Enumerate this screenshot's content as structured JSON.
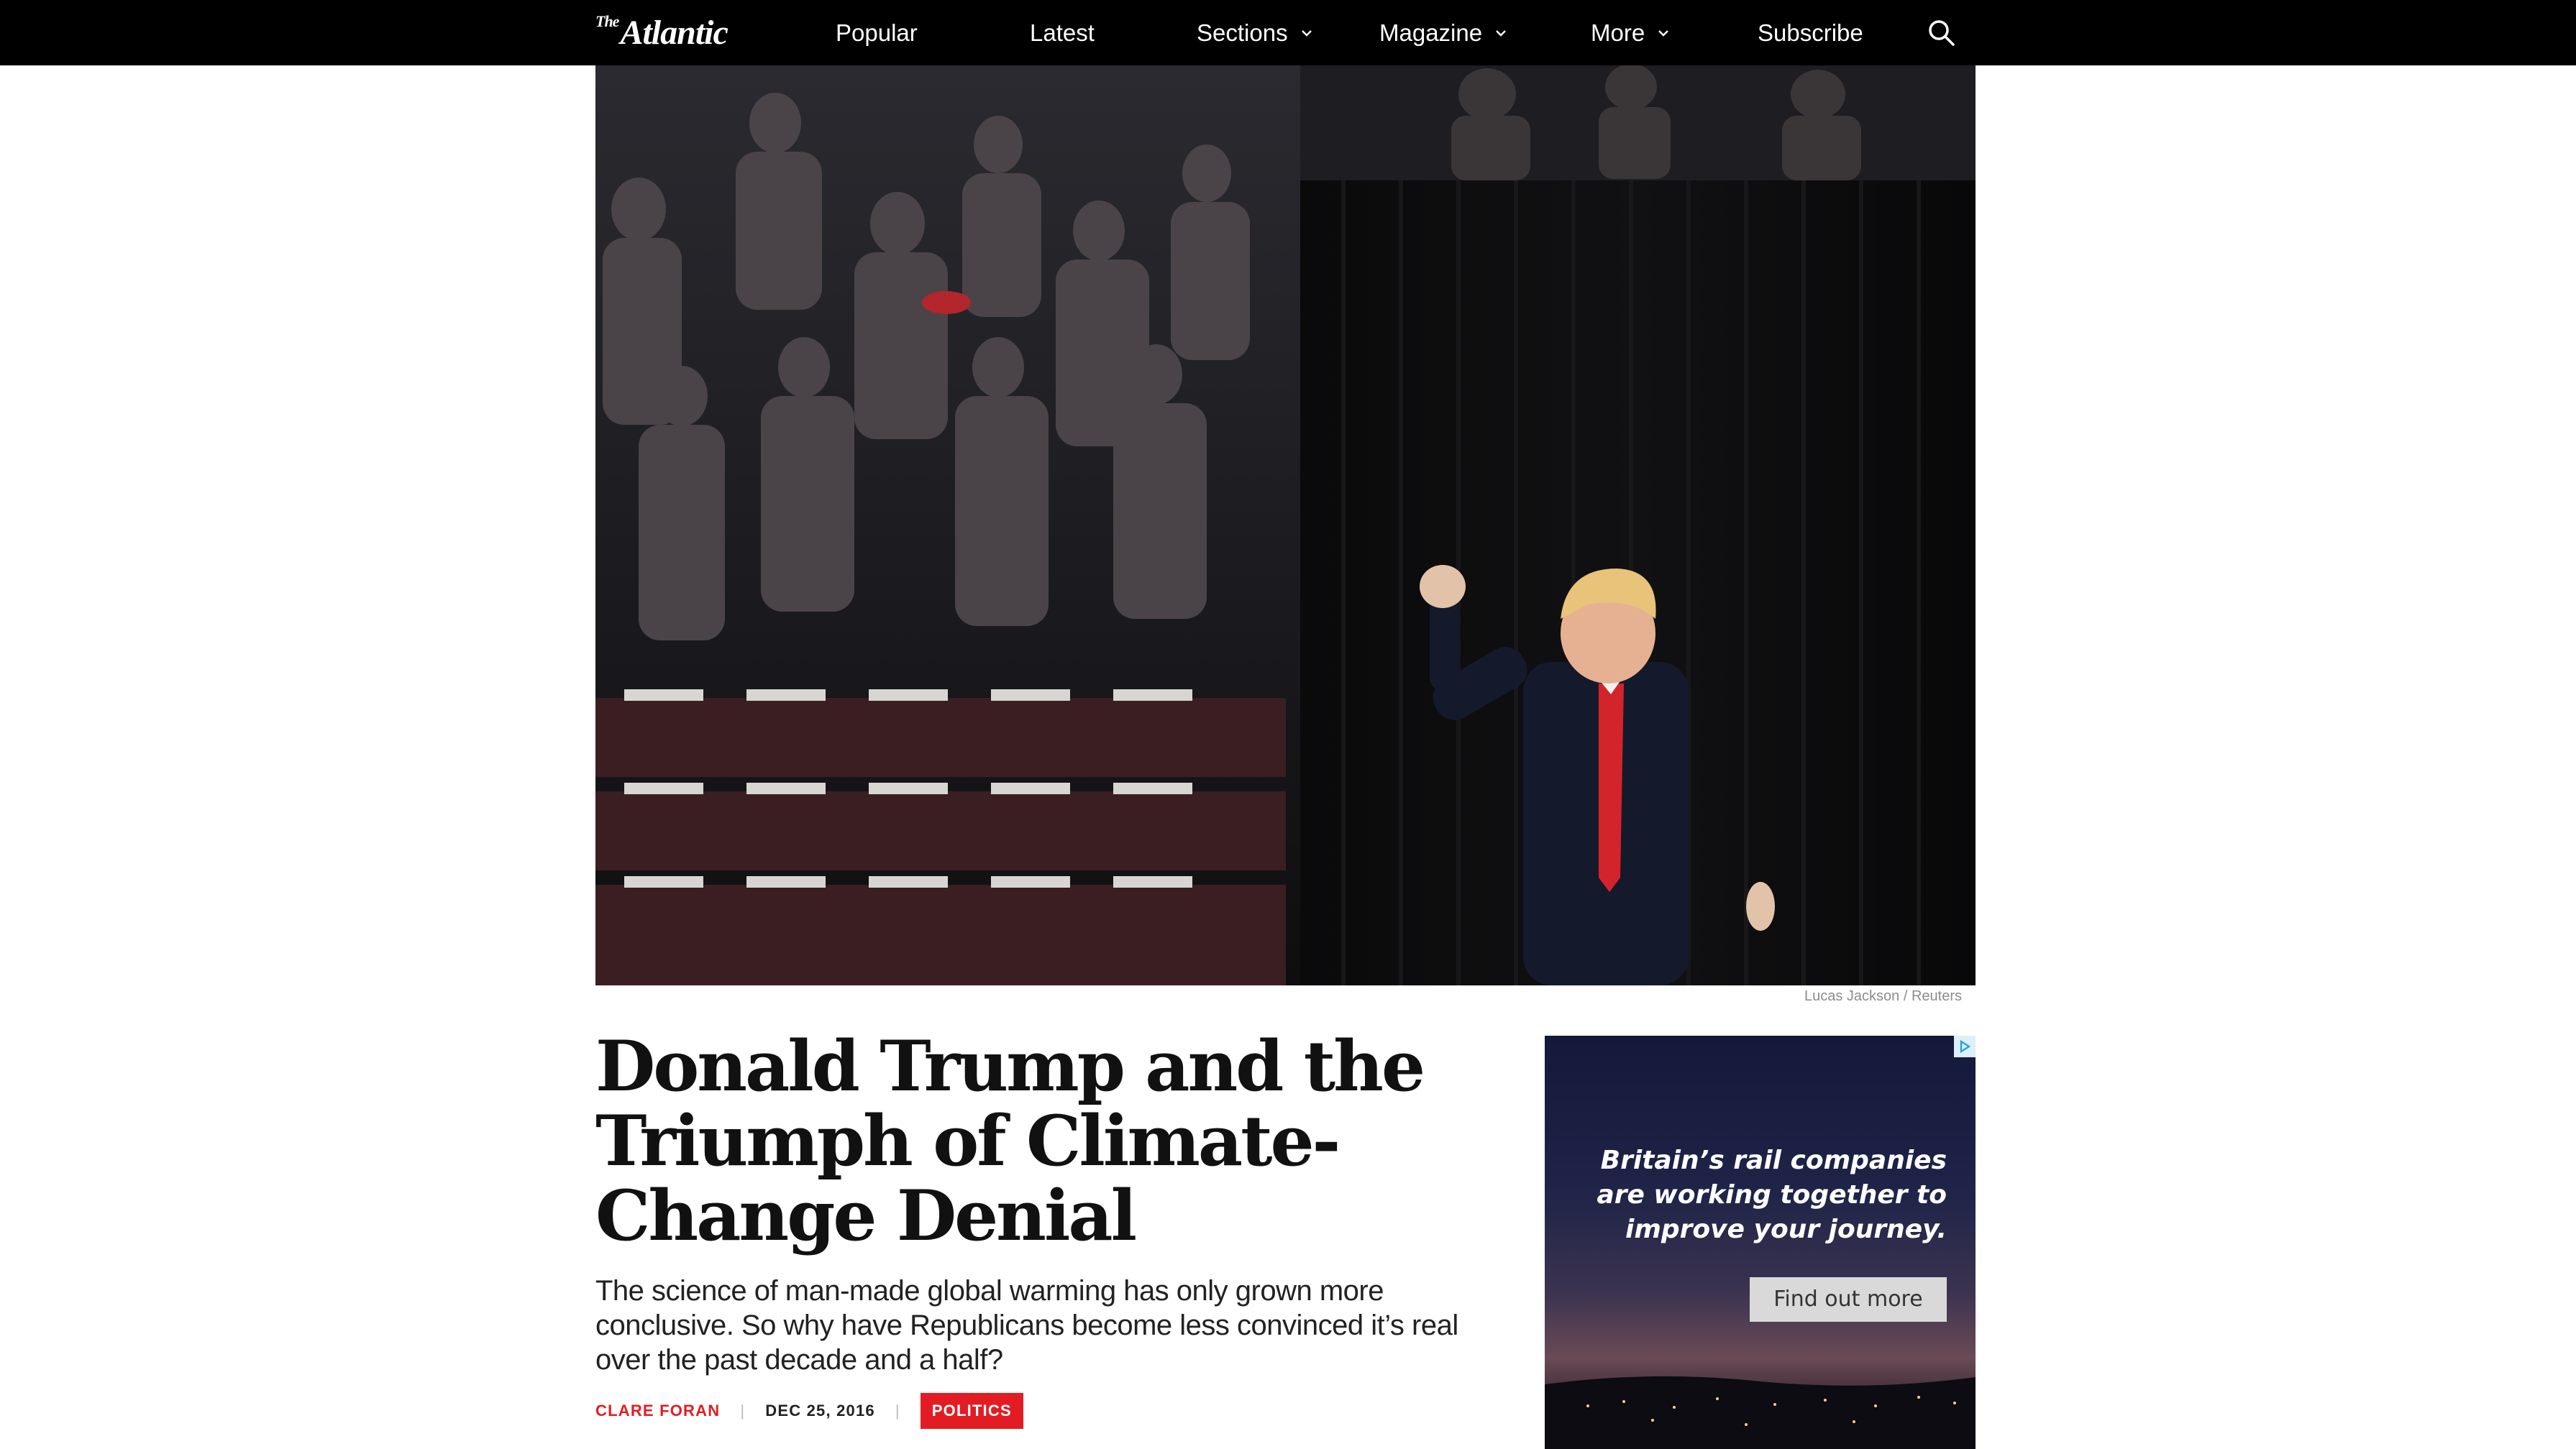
{
  "nav": {
    "logo": "The Atlantic",
    "logo_small": "The",
    "logo_main": "Atlantic",
    "items": [
      {
        "label": "Popular",
        "dropdown": false
      },
      {
        "label": "Latest",
        "dropdown": false
      },
      {
        "label": "Sections",
        "dropdown": true
      },
      {
        "label": "Magazine",
        "dropdown": true
      },
      {
        "label": "More",
        "dropdown": true
      },
      {
        "label": "Subscribe",
        "dropdown": false
      }
    ],
    "search_icon": "search-icon"
  },
  "hero": {
    "caption": "Lucas Jackson / Reuters"
  },
  "article": {
    "headline": "Donald Trump and the Triumph of Climate-Change Denial",
    "dek": "The science of man-made global warming has only grown more conclusive. So why have Republicans become less convinced it’s real over the past decade and a half?",
    "author": "CLARE FORAN",
    "date": "DEC 25, 2016",
    "section_tag": "POLITICS",
    "separator": "|"
  },
  "ad": {
    "copy": "Britain’s rail companies are working together to improve your journey.",
    "button": "Find out more",
    "adchoices_icon": "adchoices-icon"
  },
  "colors": {
    "nav_bg": "#000000",
    "accent_red": "#e31c23",
    "text": "#111111"
  }
}
